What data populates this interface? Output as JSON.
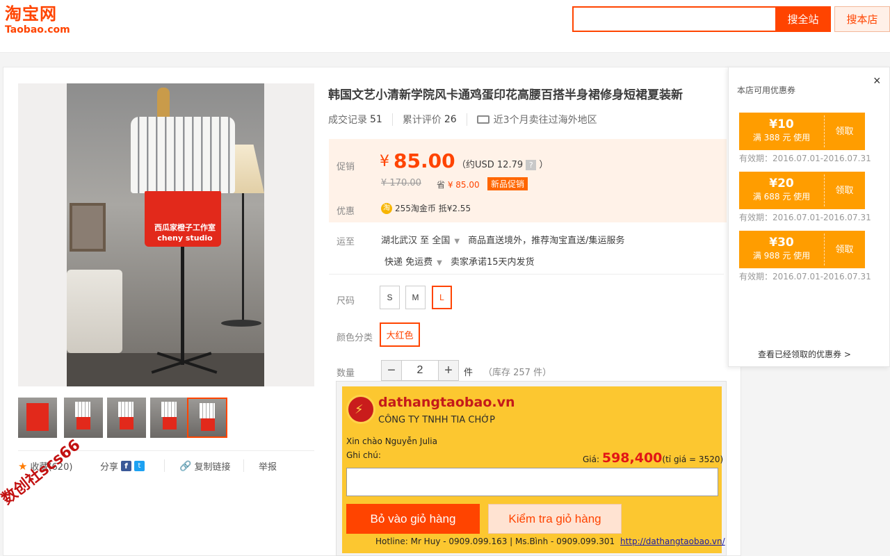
{
  "header": {
    "logo_cn": "淘宝网",
    "logo_en": "Taobao.com",
    "search_value": "",
    "search_all_label": "搜全站",
    "search_shop_label": "搜本店"
  },
  "gallery": {
    "watermark_line1": "西瓜家橙子工作室",
    "watermark_line2": "cheny studio",
    "share": {
      "collect_label": "收藏(620)",
      "share_label": "分享",
      "copy_link_label": "复制链接",
      "report_label": "举报"
    },
    "corner_stamp": "数创社scs66"
  },
  "item": {
    "title": "韩国文艺小清新学院风卡通鸡蛋印花高腰百搭半身裙修身短裙夏装新",
    "deals_label": "成交记录",
    "deals_count": "51",
    "reviews_label": "累计评价",
    "reviews_count": "26",
    "shipping_note": "近3个月卖往过海外地区",
    "promo_label": "促销",
    "currency": "¥",
    "price": "85.00",
    "usd_text": "（约USD 12.79",
    "usd_close": "）",
    "orig_price": "¥ 170.00",
    "save_prefix": "省",
    "save_amount": "¥ 85.00",
    "promo_tag": "新品促销",
    "discount_label": "优惠",
    "coin_text": "255淘金币 抵¥2.55",
    "ship_to_label": "运至",
    "ship_from": "湖北武汉",
    "ship_to_word": "至",
    "ship_dest": "全国",
    "ship_service": "商品直送境外，推荐淘宝直送/集运服务",
    "delivery_method": "快递 免运费",
    "delivery_promise": "卖家承诺15天内发货",
    "size_label": "尺码",
    "sizes": [
      "S",
      "M",
      "L"
    ],
    "selected_size": "L",
    "color_label": "颜色分类",
    "color_value": "大红色",
    "qty_label": "数量",
    "qty_value": "2",
    "qty_unit": "件",
    "stock_text": "（库存 257 件）"
  },
  "vn_box": {
    "brand": "dathangtaobao.vn",
    "company": "CÔNG TY TNHH TIA CHỚP",
    "greeting": "Xin chào Nguyễn Julia",
    "note_label": "Ghi chú:",
    "price_prefix": "Giá:",
    "price_value": "598,400",
    "rate_text": "(tỉ giá = 3520)",
    "note_value": "",
    "add_cart_label": "Bỏ vào giỏ hàng",
    "check_cart_label": "Kiểm tra giỏ hàng",
    "hotline": "Hotline: Mr Huy - 0909.099.163 | Ms.Bình - 0909.099.301",
    "url": "http://dathangtaobao.vn/"
  },
  "coupons": {
    "title": "本店可用优惠券",
    "close_glyph": "×",
    "items": [
      {
        "amount": "¥10",
        "condition": "满 388 元 使用",
        "action": "领取",
        "valid": "有效期：2016.07.01-2016.07.31"
      },
      {
        "amount": "¥20",
        "condition": "满 688 元 使用",
        "action": "领取",
        "valid": "有效期：2016.07.01-2016.07.31"
      },
      {
        "amount": "¥30",
        "condition": "满 988 元 使用",
        "action": "领取",
        "valid": "有效期：2016.07.01-2016.07.31"
      }
    ],
    "more_link": "查看已经领取的优惠券 >"
  },
  "colors": {
    "brand_orange": "#ff4400",
    "coupon_orange": "#ff9d00",
    "vn_yellow": "#fcc730",
    "price_bg": "#fff2e8"
  }
}
